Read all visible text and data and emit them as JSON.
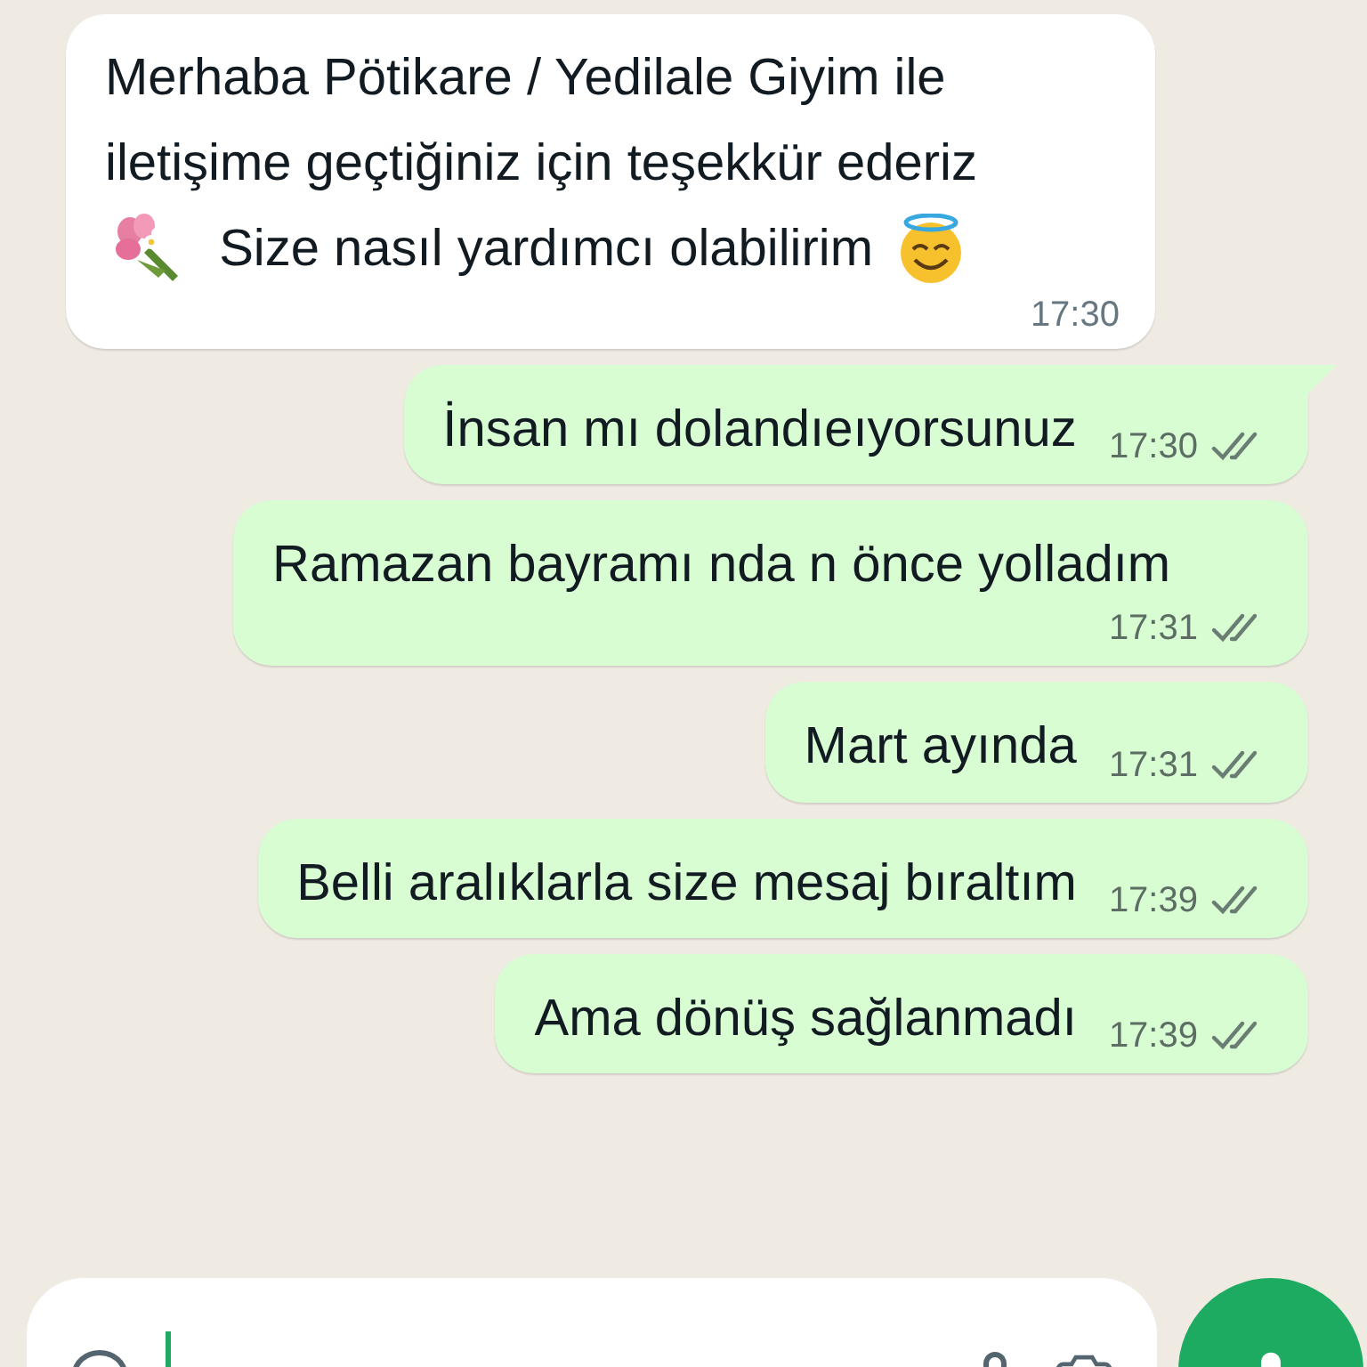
{
  "messages": [
    {
      "outgoing": false,
      "parts": [
        {
          "kind": "text",
          "text": "Merhaba Pötikare / Yedilale Giyim ile iletişime geçtiğiniz için teşekkür ederiz"
        },
        {
          "kind": "bouquet"
        },
        {
          "kind": "text",
          "text": "Size nasıl yardımcı olabilirim"
        },
        {
          "kind": "halo-face"
        }
      ],
      "time": "17:30"
    },
    {
      "outgoing": true,
      "parts": [
        {
          "kind": "text",
          "text": "İnsan mı dolandıeıyorsunuz"
        }
      ],
      "time": "17:30",
      "read": false,
      "tail": true
    },
    {
      "outgoing": true,
      "parts": [
        {
          "kind": "text",
          "text": "Ramazan bayramı nda n önce yolladım"
        }
      ],
      "time": "17:31",
      "read": false,
      "tail": false
    },
    {
      "outgoing": true,
      "parts": [
        {
          "kind": "text",
          "text": "Mart ayında"
        }
      ],
      "time": "17:31",
      "read": false,
      "tail": false
    },
    {
      "outgoing": true,
      "parts": [
        {
          "kind": "text",
          "text": "Belli aralıklarla size mesaj bıraltım"
        }
      ],
      "time": "17:39",
      "read": false,
      "tail": false
    },
    {
      "outgoing": true,
      "parts": [
        {
          "kind": "text",
          "text": "Ama dönüş sağlanmadı"
        }
      ],
      "time": "17:39",
      "read": false,
      "tail": false
    }
  ],
  "composer": {
    "focused": true
  }
}
